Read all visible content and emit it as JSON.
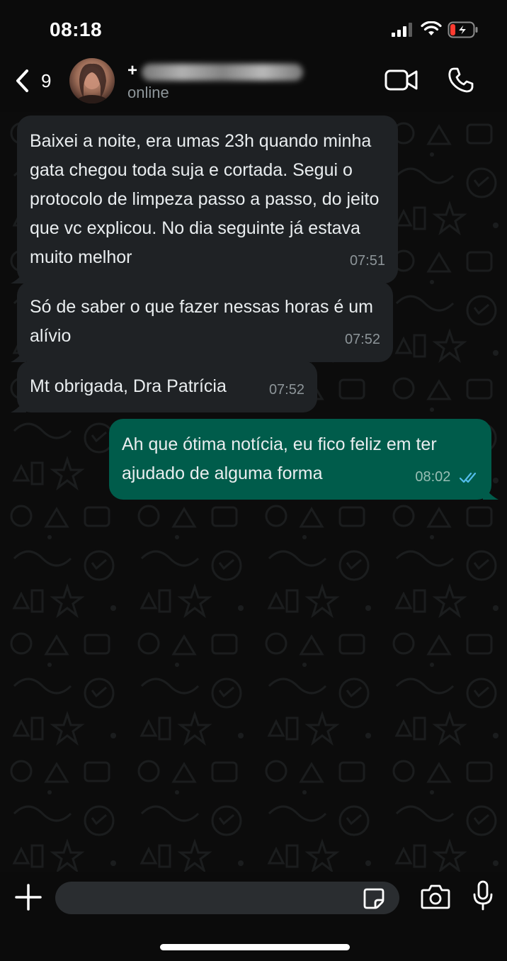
{
  "status_bar": {
    "time": "08:18"
  },
  "header": {
    "back_count": "9",
    "contact_prefix": "+",
    "contact_status": "online"
  },
  "messages": [
    {
      "direction": "incoming",
      "text": "Baixei a noite, era umas 23h quando minha gata chegou toda suja e cortada. Segui o protocolo de limpeza passo a passo, do jeito que vc explicou. No dia seguinte já estava muito melhor",
      "time": "07:51"
    },
    {
      "direction": "incoming",
      "text": "Só de saber o que fazer nessas horas é um alívio",
      "time": "07:52"
    },
    {
      "direction": "incoming",
      "text": "Mt obrigada, Dra Patrícia",
      "time": "07:52"
    },
    {
      "direction": "outgoing",
      "text": "Ah que ótima notícia, eu fico feliz em ter ajudado de alguma forma",
      "time": "08:02",
      "status": "read"
    }
  ],
  "input": {
    "placeholder": ""
  },
  "colors": {
    "background": "#0b0b0b",
    "incoming_bubble": "#1f2225",
    "outgoing_bubble": "#005c4b",
    "read_ticks": "#53bdeb",
    "battery_low": "#ff3b30"
  },
  "icons": {
    "back": "chevron-left-icon",
    "video": "video-camera-icon",
    "call": "phone-icon",
    "add": "plus-icon",
    "sticker": "sticker-icon",
    "camera": "camera-icon",
    "mic": "microphone-icon"
  }
}
